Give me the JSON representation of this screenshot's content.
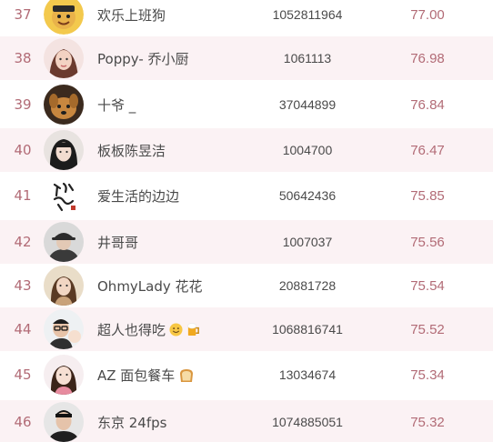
{
  "colors": {
    "rank_and_score": "#b26b76",
    "stripe": "#fbf2f4",
    "text": "#4a4a4a"
  },
  "rows": [
    {
      "rank": "37",
      "name": "欢乐上班狗",
      "id": "1052811964",
      "score": "77.00",
      "avatar_icon": "cartoon-dog-avatar-icon",
      "emoji": []
    },
    {
      "rank": "38",
      "name": "Poppy- 乔小厨",
      "id": "1061113",
      "score": "76.98",
      "avatar_icon": "woman-portrait-avatar-icon",
      "emoji": []
    },
    {
      "rank": "39",
      "name": "十爷 _",
      "id": "37044899",
      "score": "76.84",
      "avatar_icon": "dog-photo-avatar-icon",
      "emoji": []
    },
    {
      "rank": "40",
      "name": "板板陈昱洁",
      "id": "1004700",
      "score": "76.47",
      "avatar_icon": "woman-dark-hair-avatar-icon",
      "emoji": []
    },
    {
      "rank": "41",
      "name": "爱生活的边边",
      "id": "50642436",
      "score": "75.85",
      "avatar_icon": "calligraphy-logo-avatar-icon",
      "emoji": []
    },
    {
      "rank": "42",
      "name": "井哥哥",
      "id": "1007037",
      "score": "75.56",
      "avatar_icon": "person-hat-avatar-icon",
      "emoji": []
    },
    {
      "rank": "43",
      "name": "OhmyLady 花花",
      "id": "20881728",
      "score": "75.54",
      "avatar_icon": "woman-long-hair-avatar-icon",
      "emoji": []
    },
    {
      "rank": "44",
      "name": "超人也得吃",
      "id": "1068816741",
      "score": "75.52",
      "avatar_icon": "man-glasses-avatar-icon",
      "emoji": [
        "smiling-face-emoji-icon",
        "beer-mug-emoji-icon"
      ]
    },
    {
      "rank": "45",
      "name": "AZ 面包餐车",
      "id": "13034674",
      "score": "75.34",
      "avatar_icon": "girl-portrait-avatar-icon",
      "emoji": [
        "bread-emoji-icon"
      ]
    },
    {
      "rank": "46",
      "name": "东京 24fps",
      "id": "1074885051",
      "score": "75.32",
      "avatar_icon": "man-portrait-avatar-icon",
      "emoji": []
    }
  ]
}
